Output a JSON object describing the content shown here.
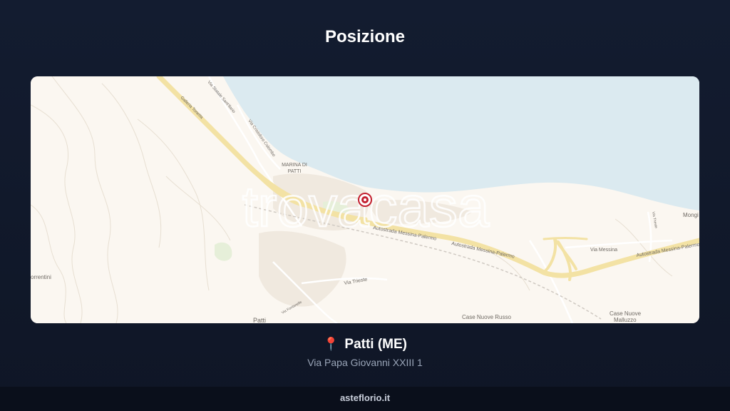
{
  "header": {
    "title": "Posizione"
  },
  "map": {
    "colors": {
      "sea": "#dbeaf0",
      "land": "#fbf7f1",
      "road": "#f3e2a4",
      "pin": "#c3202f"
    },
    "watermark": "trovacasa",
    "labels": {
      "marina": "MARINA DI",
      "marina2": "PATTI",
      "mongi": "Mongi",
      "via_messina": "Via Messina",
      "autostrada1": "Autostrada Messina-Palermo",
      "autostrada2": "Autostrada Messina-Palermo",
      "autostrada3": "Autostrada Messina-Palermo",
      "via_trieste": "Via Trieste",
      "case_russo": "Case Nuove Russo",
      "case_malluzzo1": "Case Nuove",
      "case_malluzzo2": "Malluzzo",
      "patti": "Patti",
      "sorrentini": "orrentini",
      "galleria": "Galleria Tonetta",
      "via_statale": "Via Statale Sant'Ilario",
      "via_colombo": "Via Cristoforo Colombo",
      "via_fontanelle": "Via Fontanelle",
      "via_trieste2": "Via Trieste"
    }
  },
  "location": {
    "pin_icon": "📍",
    "name": "Patti (ME)",
    "address": "Via Papa Giovanni XXIII 1"
  },
  "footer": {
    "site": "asteflorio.it"
  }
}
